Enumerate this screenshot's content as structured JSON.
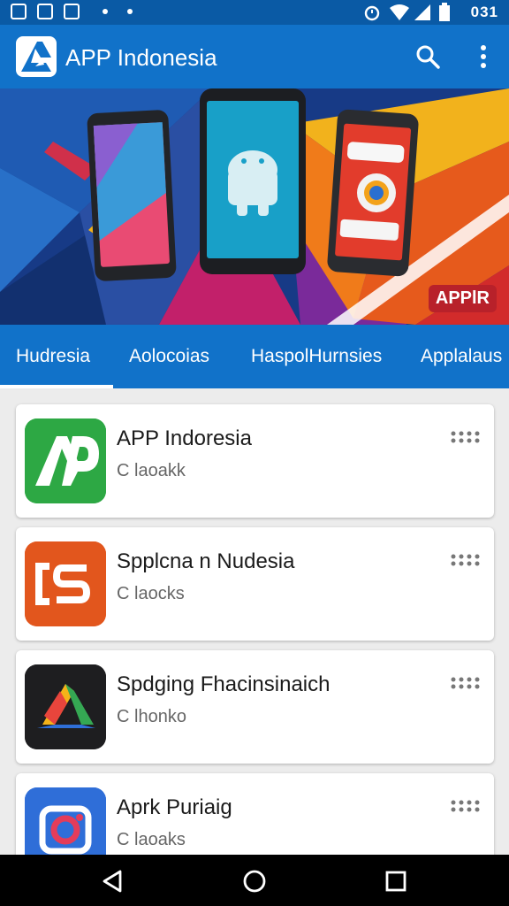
{
  "status_bar": {
    "time": "031"
  },
  "app_bar": {
    "title": "APP Indonesia"
  },
  "banner": {
    "badge": "APPlR"
  },
  "tabs": [
    "Hudresia",
    "Aolocoias",
    "HaspolHurnsies",
    "Applalaus"
  ],
  "apps": [
    {
      "name": "APP Indoresia",
      "sub": "C laoakk"
    },
    {
      "name": "Spplcna n Nudesia",
      "sub": "C laocks"
    },
    {
      "name": "Spdging Fhacinsinaich",
      "sub": "C lhonko"
    },
    {
      "name": "Aprk Puriaig",
      "sub": "C laoaks"
    }
  ],
  "colors": {
    "primary": "#1172c9",
    "status": "#0a5aa5"
  }
}
